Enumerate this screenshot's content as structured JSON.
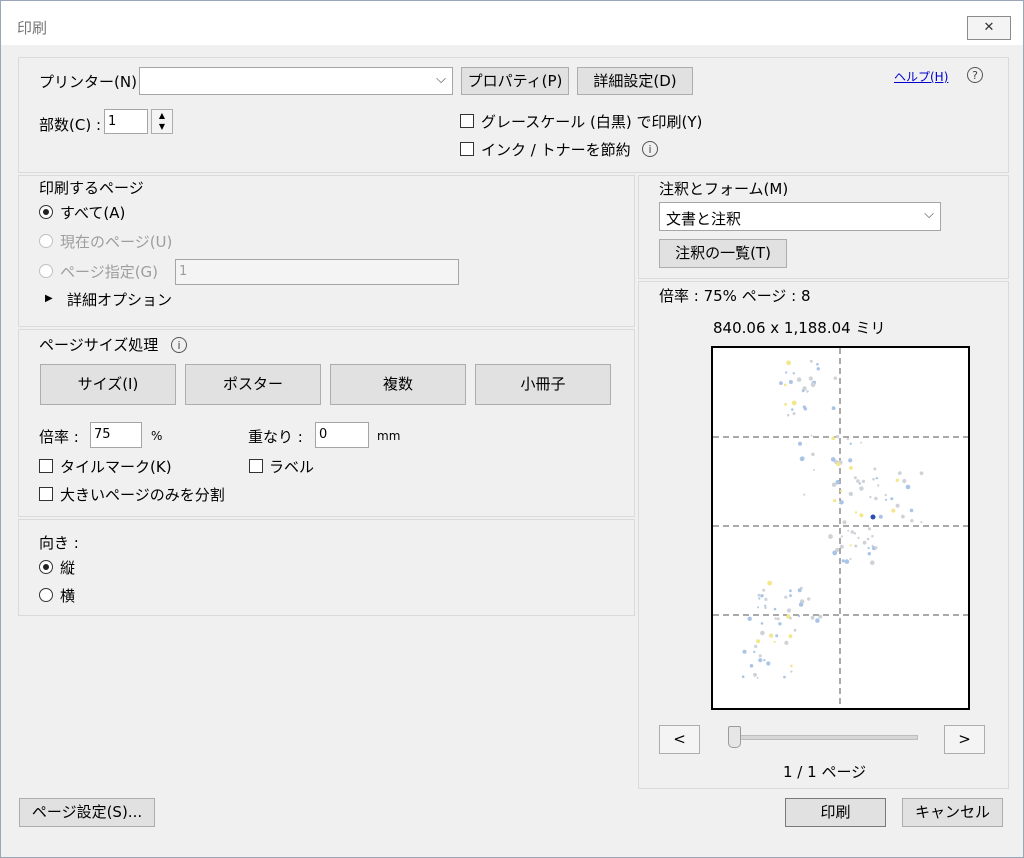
{
  "title": "印刷",
  "close_glyph": "✕",
  "printer": {
    "label": "プリンター(N) :",
    "value": "",
    "properties": "プロパティ(P)",
    "advanced": "詳細設定(D)"
  },
  "help": {
    "label": "ヘルプ(H)",
    "icon": "?"
  },
  "copies": {
    "label": "部数(C) :",
    "value": "1"
  },
  "grayscale": {
    "label": "グレースケール (白黒) で印刷(Y)",
    "checked": false
  },
  "save_ink": {
    "label": "インク / トナーを節約",
    "checked": false
  },
  "pages": {
    "title": "印刷するページ",
    "all": "すべて(A)",
    "current": "現在のページ(U)",
    "range": "ページ指定(G)",
    "range_value": "1",
    "more_options": "詳細オプション",
    "more_arrow": "▶"
  },
  "sizing": {
    "title": "ページサイズ処理",
    "buttons": [
      "サイズ(I)",
      "ポスター",
      "複数",
      "小冊子"
    ],
    "scale_label": "倍率 :",
    "scale_value": "75",
    "scale_unit": "%",
    "overlap_label": "重なり :",
    "overlap_value": "0",
    "overlap_unit": "mm",
    "tile_marks": "タイルマーク(K)",
    "labels": "ラベル",
    "large_only": "大きいページのみを分割"
  },
  "orientation": {
    "title": "向き :",
    "portrait": "縦",
    "landscape": "横"
  },
  "annotations": {
    "title": "注釈とフォーム(M)",
    "value": "文書と注釈",
    "summary_button": "注釈の一覧(T)"
  },
  "preview": {
    "scale_text": "倍率 : 75% ページ : 8",
    "dimensions": "840.06 x 1,188.04 ミリ",
    "prev": "<",
    "next": ">",
    "page_indicator": "1 / 1 ページ"
  },
  "footer": {
    "page_setup": "ページ設定(S)...",
    "print": "印刷",
    "cancel": "キャンセル"
  },
  "colors": {
    "dot_blue": "#aac4e6",
    "dot_yellow": "#f2e78a",
    "dot_gray": "#cfd3d8",
    "dot_accent": "#2a4fb0"
  }
}
